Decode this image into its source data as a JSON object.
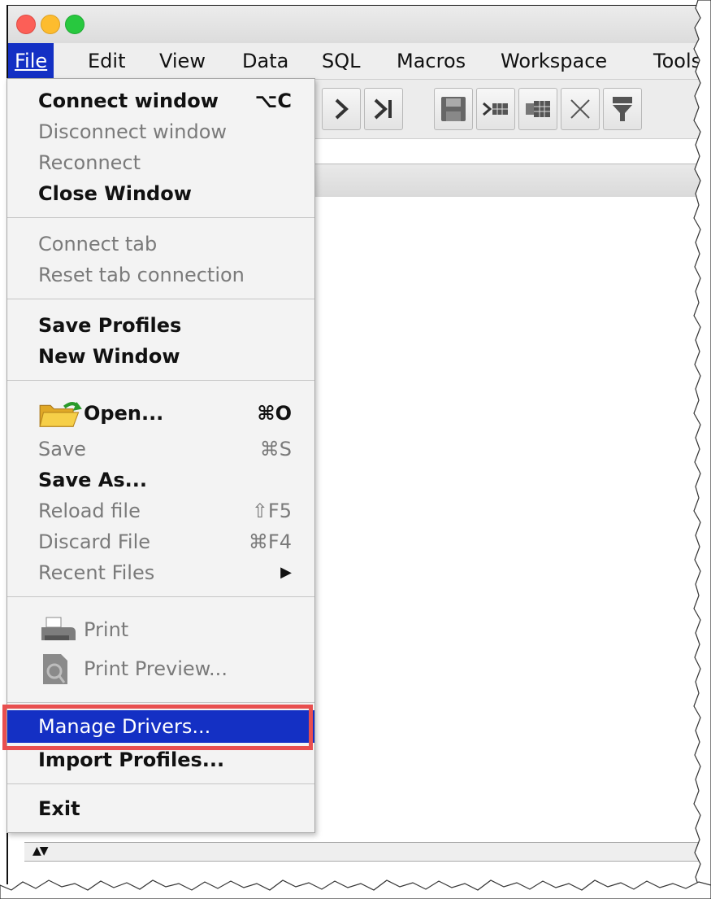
{
  "menubar": {
    "items": [
      {
        "label": "File",
        "active": true
      },
      {
        "label": "Edit"
      },
      {
        "label": "View"
      },
      {
        "label": "Data"
      },
      {
        "label": "SQL"
      },
      {
        "label": "Macros"
      },
      {
        "label": "Workspace"
      },
      {
        "label": "Tools"
      }
    ]
  },
  "file_menu": {
    "groups": [
      {
        "items": [
          {
            "label": "Connect window",
            "shortcut": "⌥C",
            "state": "enabled-bold"
          },
          {
            "label": "Disconnect window",
            "state": "disabled"
          },
          {
            "label": "Reconnect",
            "state": "disabled"
          },
          {
            "label": "Close Window",
            "state": "enabled-bold"
          }
        ]
      },
      {
        "items": [
          {
            "label": "Connect tab",
            "state": "disabled"
          },
          {
            "label": "Reset tab connection",
            "state": "disabled"
          }
        ]
      },
      {
        "items": [
          {
            "label": "Save Profiles",
            "state": "enabled-bold"
          },
          {
            "label": "New Window",
            "state": "enabled-bold"
          }
        ]
      },
      {
        "items": [
          {
            "label": "Open...",
            "shortcut": "⌘O",
            "icon": "folder-open-icon",
            "state": "enabled-bold"
          },
          {
            "label": "Save",
            "shortcut": "⌘S",
            "state": "disabled"
          },
          {
            "label": "Save As...",
            "state": "enabled-bold"
          },
          {
            "label": "Reload file",
            "shortcut": "⇧F5",
            "state": "disabled"
          },
          {
            "label": "Discard File",
            "shortcut": "⌘F4",
            "state": "disabled"
          },
          {
            "label": "Recent Files",
            "submenu_arrow": "▶",
            "state": "disabled"
          }
        ]
      },
      {
        "items": [
          {
            "label": "Print",
            "icon": "printer-icon",
            "state": "disabled"
          },
          {
            "label": "Print Preview...",
            "icon": "print-preview-icon",
            "state": "disabled"
          }
        ]
      },
      {
        "items": [
          {
            "label": "Manage Drivers...",
            "state": "highlighted"
          },
          {
            "label": "Import Profiles...",
            "state": "enabled-bold"
          }
        ]
      },
      {
        "items": [
          {
            "label": "Exit",
            "state": "enabled-bold"
          }
        ]
      }
    ]
  },
  "colors": {
    "menu_highlight": "#1430c4",
    "annotation_box": "#e84f4f",
    "traffic_close": "#fc5f57",
    "traffic_minimize": "#fdbc2e",
    "traffic_zoom": "#28c83f"
  }
}
